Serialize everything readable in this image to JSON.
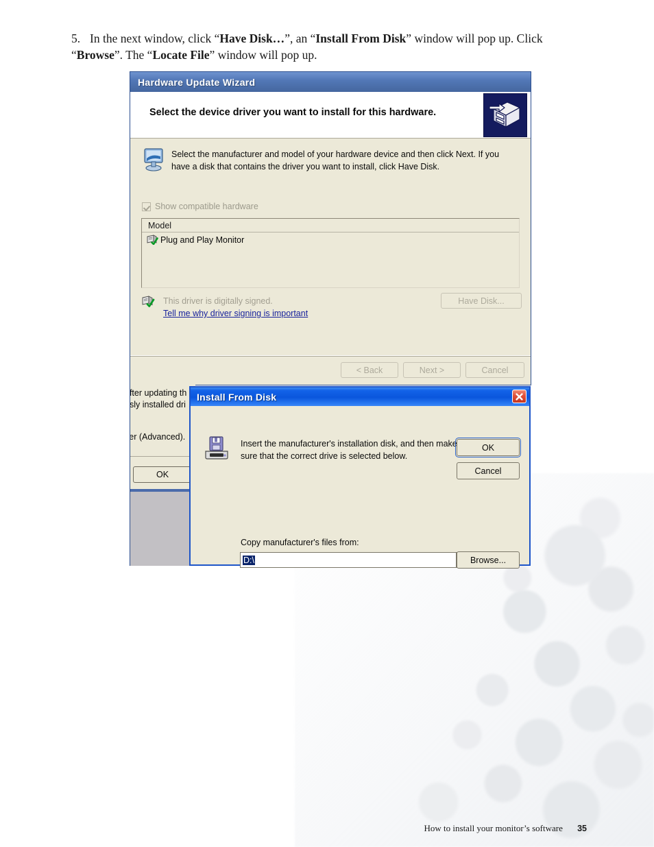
{
  "step": {
    "number": "5.",
    "text_segments": [
      {
        "t": "In the next window, click “",
        "b": false
      },
      {
        "t": "Have Disk…",
        "b": true
      },
      {
        "t": "”, an “",
        "b": false
      },
      {
        "t": "Install From Disk",
        "b": true
      },
      {
        "t": "” window will pop up. Click “",
        "b": false
      },
      {
        "t": "Browse",
        "b": true
      },
      {
        "t": "”. The “",
        "b": false
      },
      {
        "t": "Locate File",
        "b": true
      },
      {
        "t": "” window will pop up.",
        "b": false
      }
    ]
  },
  "wizard": {
    "title": "Hardware Update Wizard",
    "header_title": "Select the device driver you want to install for this hardware.",
    "header_icon": "hardware-device-icon",
    "instructions": "Select the manufacturer and model of your hardware device and then click Next. If you have a disk that contains the driver you want to install, click Have Disk.",
    "device_icon": "monitor-icon",
    "show_compatible": {
      "label": "Show compatible hardware",
      "checked": true,
      "disabled": true
    },
    "list": {
      "column_header": "Model",
      "rows": [
        {
          "icon": "signed-driver-icon",
          "label": "Plug and Play Monitor"
        }
      ]
    },
    "signing": {
      "icon": "signed-driver-icon",
      "status": "This driver is digitally signed.",
      "link": "Tell me why driver signing is important"
    },
    "have_disk_label": "Have Disk...",
    "footer_buttons": [
      {
        "label": "< Back",
        "disabled": true
      },
      {
        "label": "Next >",
        "disabled": true
      },
      {
        "label": "Cancel",
        "disabled": true
      }
    ]
  },
  "behind_window": {
    "line1": "after updating th",
    "line2": "usly installed dri",
    "line3": "ver (Advanced).",
    "ok_label": "OK"
  },
  "install_from_disk": {
    "title": "Install From Disk",
    "close_icon": "close-icon",
    "disk_icon": "floppy-drive-icon",
    "message": "Insert the manufacturer's installation disk, and then make sure that the correct drive is selected below.",
    "ok_label": "OK",
    "cancel_label": "Cancel",
    "copy_from_label": "Copy manufacturer's files from:",
    "path_value": "D:\\",
    "dropdown_icon": "chevron-down-icon",
    "browse_label": "Browse..."
  },
  "footer": {
    "text": "How to install your monitor’s software",
    "page": "35"
  },
  "colors": {
    "wizard_titlebar": "#5277b6",
    "dialog_titlebar": "#0a56dd",
    "dialog_face": "#ece9d8",
    "close_button": "#c5361f",
    "link": "#19239c",
    "selection": "#0a246a"
  }
}
